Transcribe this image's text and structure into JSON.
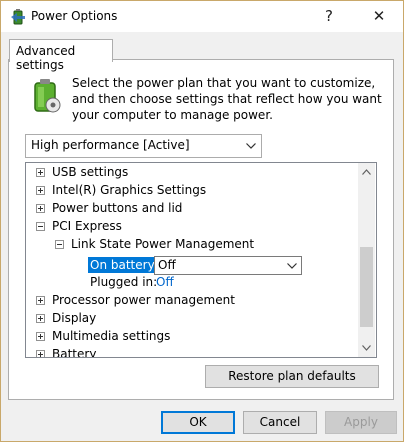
{
  "window": {
    "title": "Power Options",
    "help_label": "?",
    "close_label": "✕"
  },
  "tab": {
    "label": "Advanced settings"
  },
  "description": "Select the power plan that you want to customize, and then choose settings that reflect how you want your computer to manage power.",
  "plan_select": {
    "value": "High performance [Active]"
  },
  "tree": {
    "items": [
      {
        "label": "USB settings",
        "state": "collapsed"
      },
      {
        "label": "Intel(R) Graphics Settings",
        "state": "collapsed"
      },
      {
        "label": "Power buttons and lid",
        "state": "collapsed"
      },
      {
        "label": "PCI Express",
        "state": "expanded"
      },
      {
        "label": "Link State Power Management",
        "state": "expanded"
      },
      {
        "label": "Processor power management",
        "state": "collapsed"
      },
      {
        "label": "Display",
        "state": "collapsed"
      },
      {
        "label": "Multimedia settings",
        "state": "collapsed"
      },
      {
        "label": "Battery",
        "state": "collapsed"
      }
    ],
    "on_battery": {
      "label": "On battery:",
      "value": "Off"
    },
    "plugged_in": {
      "label": "Plugged in:",
      "value": "Off"
    }
  },
  "buttons": {
    "restore": "Restore plan defaults",
    "ok": "OK",
    "cancel": "Cancel",
    "apply": "Apply"
  },
  "colors": {
    "selection": "#0078d7",
    "link": "#0066cc"
  }
}
